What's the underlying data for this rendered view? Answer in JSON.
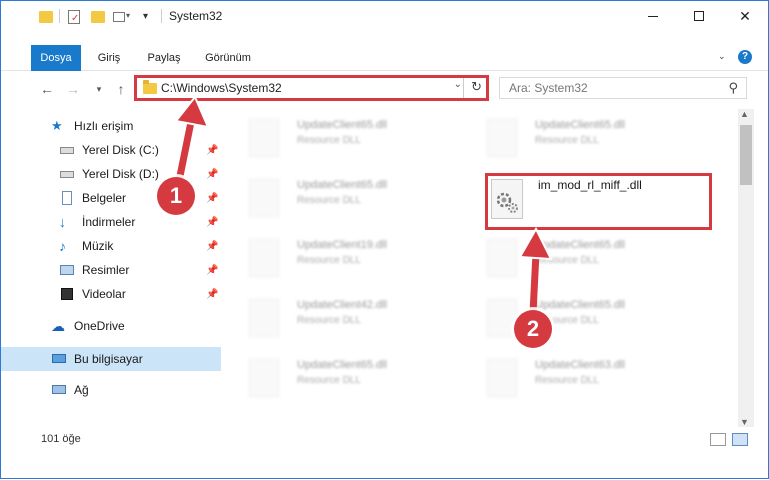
{
  "window": {
    "title": "System32"
  },
  "ribbon": {
    "tabs": [
      {
        "label": "Dosya",
        "active": true
      },
      {
        "label": "Giriş"
      },
      {
        "label": "Paylaş"
      },
      {
        "label": "Görünüm"
      }
    ]
  },
  "address": {
    "path": "C:\\Windows\\System32"
  },
  "search": {
    "placeholder": "Ara: System32"
  },
  "sidebar": {
    "quick_access": "Hızlı erişim",
    "items": [
      {
        "label": "Yerel Disk (C:)"
      },
      {
        "label": "Yerel Disk (D:)"
      },
      {
        "label": "Belgeler"
      },
      {
        "label": "İndirmeler"
      },
      {
        "label": "Müzik"
      },
      {
        "label": "Resimler"
      },
      {
        "label": "Videolar"
      }
    ],
    "onedrive": "OneDrive",
    "this_pc": "Bu bilgisayar",
    "network": "Ağ"
  },
  "files": {
    "left": [
      {
        "name": "UpdateClient65.dll",
        "desc": "Resource DLL"
      },
      {
        "name": "UpdateClient65.dll",
        "desc": "Resource DLL"
      },
      {
        "name": "UpdateClient19.dll",
        "desc": "Resource DLL"
      },
      {
        "name": "UpdateClient42.dll",
        "desc": "Resource DLL"
      },
      {
        "name": "UpdateClient65.dll",
        "desc": "Resource DLL"
      }
    ],
    "right": [
      {
        "name": "UpdateClient65.dll",
        "desc": "Resource DLL"
      },
      {
        "name": "UpdateClient65.dll",
        "desc": "Resource DLL"
      },
      {
        "name": "UpdateClient65.dll",
        "desc": "Resource DLL"
      },
      {
        "name": "UpdateClient63.dll",
        "desc": "Resource DLL"
      }
    ],
    "highlighted": "im_mod_rl_miff_.dll"
  },
  "status": {
    "count": "101 öğe"
  },
  "annotations": {
    "badge1": "1",
    "badge2": "2"
  },
  "colors": {
    "accent": "#1979ca",
    "highlight_red": "#d43a40",
    "selection": "#cce4f7"
  }
}
